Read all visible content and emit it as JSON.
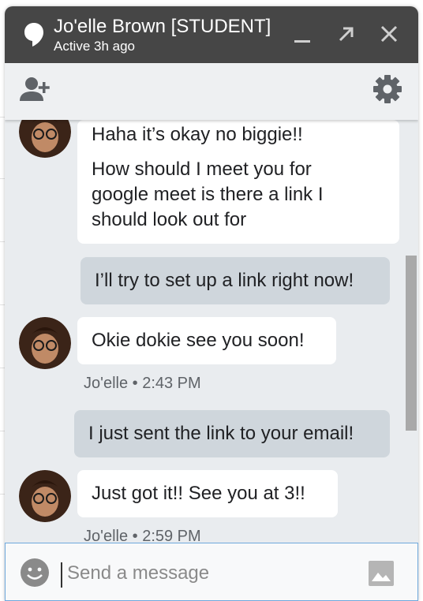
{
  "header": {
    "name": "Jo'elle Brown [STUDENT]",
    "status": "Active 3h ago",
    "minimize_icon": "minimize-icon",
    "popout_icon": "popout-icon",
    "close_icon": "close-icon"
  },
  "toolbar": {
    "add_people_icon": "add-person-icon",
    "settings_icon": "gear-icon"
  },
  "messages": [
    {
      "direction": "incoming",
      "lines": [
        "Haha it’s okay no biggie!!"
      ]
    },
    {
      "direction": "incoming",
      "lines": [
        "How should I meet you for",
        "google meet is there a link I",
        "should look out for"
      ]
    },
    {
      "direction": "outgoing",
      "lines": [
        "I’ll try to set up a link right now!"
      ]
    },
    {
      "direction": "incoming",
      "lines": [
        "Okie dokie see you soon!"
      ],
      "meta": "Jo'elle • 2:43 PM"
    },
    {
      "direction": "outgoing",
      "lines": [
        "I just sent the link to your email!"
      ]
    },
    {
      "direction": "incoming",
      "lines": [
        "Just got it!! See you at 3!!"
      ],
      "meta": "Jo'elle • 2:59 PM"
    }
  ],
  "composer": {
    "placeholder": "Send a message",
    "emoji_icon": "emoji-icon",
    "image_icon": "image-icon"
  },
  "colors": {
    "titlebar": "#464646",
    "outgoing_bubble": "#cfd6dc",
    "incoming_bubble": "#ffffff",
    "focus_border": "#6fa8dc"
  }
}
